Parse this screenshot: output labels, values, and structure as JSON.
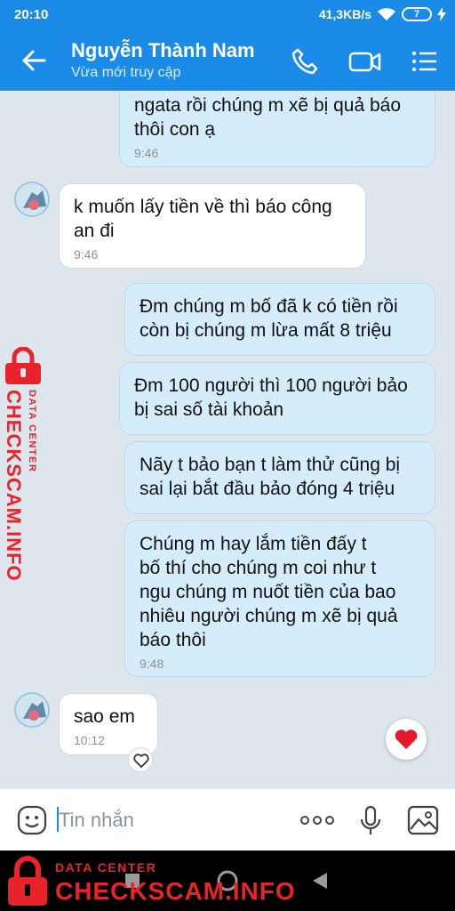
{
  "status": {
    "time": "20:10",
    "speed": "41,3KB/s",
    "battery": "7"
  },
  "header": {
    "contact_name": "Nguyễn Thành Nam",
    "status": "Vừa mới truy cập"
  },
  "messages": [
    {
      "side": "out",
      "text": "ngata rồi chúng m xẽ bị quả báo\nthôi con ạ",
      "time": "9:46"
    },
    {
      "side": "in",
      "text": "k muốn lấy tiền về thì báo công\nan đi",
      "time": "9:46"
    },
    {
      "side": "out",
      "text": "Đm chúng m bố đã k có tiền rồi\ncòn bị chúng m lừa mất 8 triệu",
      "time": ""
    },
    {
      "side": "out",
      "text": "Đm 100 người thì 100 người bảo\nbị sai số tài khoản",
      "time": ""
    },
    {
      "side": "out",
      "text": "Nãy t bảo bạn t làm thử cũng bị\nsai lại bắt đầu bảo đóng 4 triệu",
      "time": ""
    },
    {
      "side": "out",
      "text": "Chúng m hay lắm tiền đấy t\nbố thí cho chúng m  coi như t\nngu chúng m nuốt tiền của bao\nnhiêu người chúng m xẽ bị quả\nbáo thôi",
      "time": "9:48"
    },
    {
      "side": "in",
      "text": "sao em",
      "time": "10:12"
    }
  ],
  "input": {
    "placeholder": "Tin nhắn"
  },
  "watermark": {
    "label": "DATA CENTER",
    "brand": "CHECKSCAM.INFO"
  },
  "colors": {
    "header": "#1a8be6",
    "outgoing_bubble": "#d5ecfb",
    "incoming_bubble": "#ffffff",
    "watermark": "#e8232a"
  },
  "icons": [
    "back-arrow-icon",
    "phone-icon",
    "video-call-icon",
    "menu-list-icon",
    "sticker-icon",
    "more-dots-icon",
    "microphone-icon",
    "image-icon",
    "heart-icon",
    "lock-icon"
  ]
}
